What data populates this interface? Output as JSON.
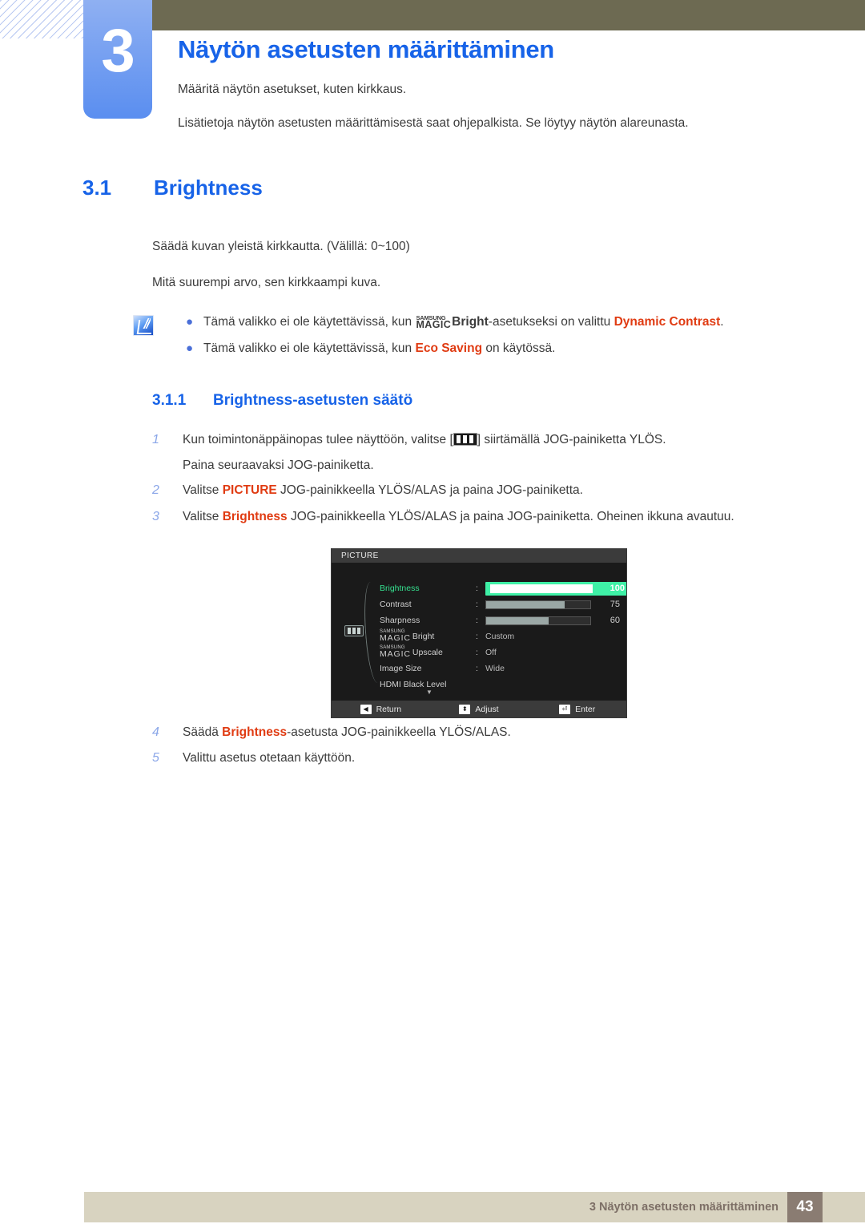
{
  "chapter": {
    "number": "3",
    "title": "Näytön asetusten määrittäminen",
    "intro1": "Määritä näytön asetukset, kuten kirkkaus.",
    "intro2": "Lisätietoja näytön asetusten määrittämisestä saat ohjepalkista. Se löytyy näytön alareunasta."
  },
  "section": {
    "number": "3.1",
    "title": "Brightness",
    "para1": "Säädä kuvan yleistä kirkkautta. (Välillä: 0~100)",
    "para2": "Mitä suurempi arvo, sen kirkkaampi kuva."
  },
  "note": {
    "icon": "note-pen-icon",
    "bullets": [
      {
        "pre": "Tämä valikko ei ole käytettävissä, kun ",
        "magic_top": "SAMSUNG",
        "magic_bottom": "MAGIC",
        "magic_suffix": "Bright",
        "mid": "-asetukseksi on valittu ",
        "highlight": "Dynamic Contrast",
        "post": "."
      },
      {
        "pre": "Tämä valikko ei ole käytettävissä, kun ",
        "highlight": "Eco Saving",
        "post": " on käytössä."
      }
    ]
  },
  "subsection": {
    "number": "3.1.1",
    "title": "Brightness-asetusten säätö"
  },
  "steps": [
    {
      "index": "1",
      "pre": "Kun toimintonäppäinopas tulee näyttöön, valitse [",
      "icon": "picture-menu-icon",
      "post": "] siirtämällä JOG-painiketta YLÖS.",
      "continuation": "Paina seuraavaksi JOG-painiketta."
    },
    {
      "index": "2",
      "pre": "Valitse ",
      "highlight": "PICTURE",
      "post": " JOG-painikkeella YLÖS/ALAS ja paina JOG-painiketta."
    },
    {
      "index": "3",
      "pre": "Valitse ",
      "highlight": "Brightness",
      "post": " JOG-painikkeella YLÖS/ALAS ja paina JOG-painiketta. Oheinen ikkuna avautuu."
    },
    {
      "index": "4",
      "pre": "Säädä ",
      "highlight": "Brightness",
      "post": "-asetusta JOG-painikkeella YLÖS/ALAS."
    },
    {
      "index": "5",
      "pre": "Valittu asetus otetaan käyttöön.",
      "highlight": "",
      "post": ""
    }
  ],
  "osd": {
    "title": "PICTURE",
    "side_icon": "picture-menu-icon",
    "rows": [
      {
        "label": "Brightness",
        "colon": ":",
        "type": "slider",
        "value": "100",
        "percent": 100,
        "selected": true
      },
      {
        "label": "Contrast",
        "colon": ":",
        "type": "slider",
        "value": "75",
        "percent": 75,
        "selected": false
      },
      {
        "label": "Sharpness",
        "colon": ":",
        "type": "slider",
        "value": "60",
        "percent": 60,
        "selected": false
      },
      {
        "label_magic_top": "SAMSUNG",
        "label_magic_bottom": "MAGIC",
        "label_suffix": "Bright",
        "colon": ":",
        "type": "value",
        "value": "Custom",
        "selected": false
      },
      {
        "label_magic_top": "SAMSUNG",
        "label_magic_bottom": "MAGIC",
        "label_suffix": "Upscale",
        "colon": ":",
        "type": "value",
        "value": "Off",
        "selected": false
      },
      {
        "label": "Image Size",
        "colon": ":",
        "type": "value",
        "value": "Wide",
        "selected": false
      },
      {
        "label": "HDMI Black Level",
        "colon": "",
        "type": "none",
        "value": "",
        "selected": false
      }
    ],
    "scroll_arrow": "▼",
    "footer": [
      {
        "key": "◀",
        "label": "Return"
      },
      {
        "key": "⬍",
        "label": "Adjust"
      },
      {
        "key": "⏎",
        "label": "Enter"
      }
    ]
  },
  "footer": {
    "text": "3 Näytön asetusten määrittäminen",
    "page": "43"
  },
  "colors": {
    "accent_blue": "#1763e8",
    "tab_blue_top": "#8fb0f2",
    "tab_blue_bottom": "#5a8ef0",
    "olive": "#6d6a52",
    "highlight_red": "#e03b12",
    "osd_green": "#3ff0a6",
    "footer_beige": "#d8d3c0",
    "footer_brown": "#8a7c72"
  }
}
